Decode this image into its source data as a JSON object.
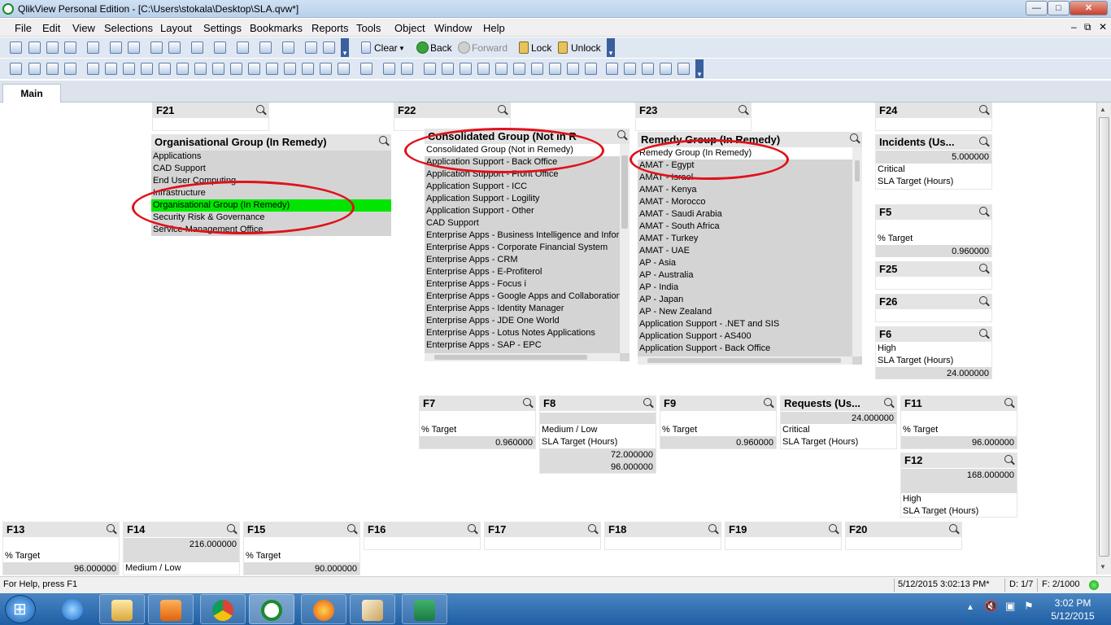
{
  "window": {
    "title": "QlikView Personal Edition - [C:\\Users\\stokala\\Desktop\\SLA.qvw*]",
    "min": "—",
    "max": "□",
    "close": "✕"
  },
  "menu": {
    "items": [
      "File",
      "Edit",
      "View",
      "Selections",
      "Layout",
      "Settings",
      "Bookmarks",
      "Reports",
      "Tools",
      "Object",
      "Window",
      "Help"
    ],
    "mdi_min": "–",
    "mdi_restore": "⧉",
    "mdi_close": "✕"
  },
  "toolbar": {
    "clear": "Clear",
    "back": "Back",
    "forward": "Forward",
    "lock": "Lock",
    "unlock": "Unlock"
  },
  "tabs": [
    "Main"
  ],
  "objects": {
    "f21": {
      "caption": "F21"
    },
    "f22": {
      "caption": "F22"
    },
    "f23": {
      "caption": "F23"
    },
    "f24": {
      "caption": "F24"
    },
    "org_group": {
      "caption": "Organisational Group (In Remedy)",
      "items": [
        "Applications",
        "CAD Support",
        "End User Computing",
        "Infrastructure",
        "Organisational Group (In Remedy)",
        "Security Risk & Governance",
        "Service Management Office"
      ]
    },
    "cons_group": {
      "caption": "Consolidated Group (Not in R",
      "items": [
        "Consolidated Group (Not in Remedy)",
        "Application Support - Back Office",
        "Application Support - Front Office",
        "Application Support - ICC",
        "Application Support - Logility",
        "Application Support - Other",
        "CAD Support",
        "Enterprise Apps - Business Intelligence and Inform",
        "Enterprise Apps - Corporate Financial System",
        "Enterprise Apps - CRM",
        "Enterprise Apps - E-Profiterol",
        "Enterprise Apps - Focus i",
        "Enterprise Apps - Google Apps and Collaboration",
        "Enterprise Apps - Identity Manager",
        "Enterprise Apps - JDE One World",
        "Enterprise Apps - Lotus Notes Applications",
        "Enterprise Apps - SAP - EPC"
      ]
    },
    "remedy_group": {
      "caption": "Remedy Group (In Remedy)",
      "items": [
        "Remedy Group (In Remedy)",
        "AMAT - Egypt",
        "AMAT - Israel",
        "AMAT - Kenya",
        "AMAT - Morocco",
        "AMAT - Saudi Arabia",
        "AMAT - South Africa",
        "AMAT - Turkey",
        "AMAT - UAE",
        "AP - Asia",
        "AP - Australia",
        "AP - India",
        "AP - Japan",
        "AP - New Zealand",
        "Application Support - .NET and SIS",
        "Application Support - AS400",
        "Application Support - Back Office"
      ]
    },
    "incidents": {
      "caption": "Incidents (Us...",
      "value": "5.000000",
      "line1": "Critical",
      "line2": "SLA Target (Hours)"
    },
    "f5": {
      "caption": "F5",
      "label": "% Target",
      "value": "0.960000"
    },
    "f25": {
      "caption": "F25"
    },
    "f26": {
      "caption": "F26"
    },
    "f6": {
      "caption": "F6",
      "line1": "High",
      "line2": "SLA Target (Hours)",
      "value": "24.000000"
    },
    "f7": {
      "caption": "F7",
      "label": "% Target",
      "value": "0.960000"
    },
    "f8": {
      "caption": "F8",
      "line1": "Medium / Low",
      "line2": "SLA Target (Hours)",
      "value1": "72.000000",
      "value2": "96.000000"
    },
    "f9": {
      "caption": "F9",
      "label": "% Target",
      "value": "0.960000"
    },
    "requests": {
      "caption": "Requests (Us...",
      "value": "24.000000",
      "line1": "Critical",
      "line2": "SLA Target (Hours)"
    },
    "f11": {
      "caption": "F11",
      "label": "% Target",
      "value": "96.000000"
    },
    "f12": {
      "caption": "F12",
      "value": "168.000000",
      "line1": "High",
      "line2": "SLA Target (Hours)"
    },
    "f13": {
      "caption": "F13",
      "label": "% Target",
      "value": "96.000000"
    },
    "f14": {
      "caption": "F14",
      "value": "216.000000",
      "line1": "Medium / Low"
    },
    "f15": {
      "caption": "F15",
      "label": "% Target",
      "value": "90.000000"
    },
    "f16": {
      "caption": "F16"
    },
    "f17": {
      "caption": "F17"
    },
    "f18": {
      "caption": "F18"
    },
    "f19": {
      "caption": "F19"
    },
    "f20": {
      "caption": "F20"
    }
  },
  "status": {
    "help": "For Help, press F1",
    "timestamp": "5/12/2015 3:02:13 PM*",
    "d": "D: 1/7",
    "f": "F: 2/1000"
  },
  "taskbar": {
    "apps": [
      "internet-explorer",
      "file-explorer",
      "media-player",
      "chrome",
      "qlikview",
      "firefox",
      "paint",
      "excel"
    ],
    "time": "3:02 PM",
    "date": "5/12/2015"
  },
  "colors": {
    "selected": "#00e600",
    "excluded": "#d4d4d4",
    "annotation": "#e0111b"
  }
}
